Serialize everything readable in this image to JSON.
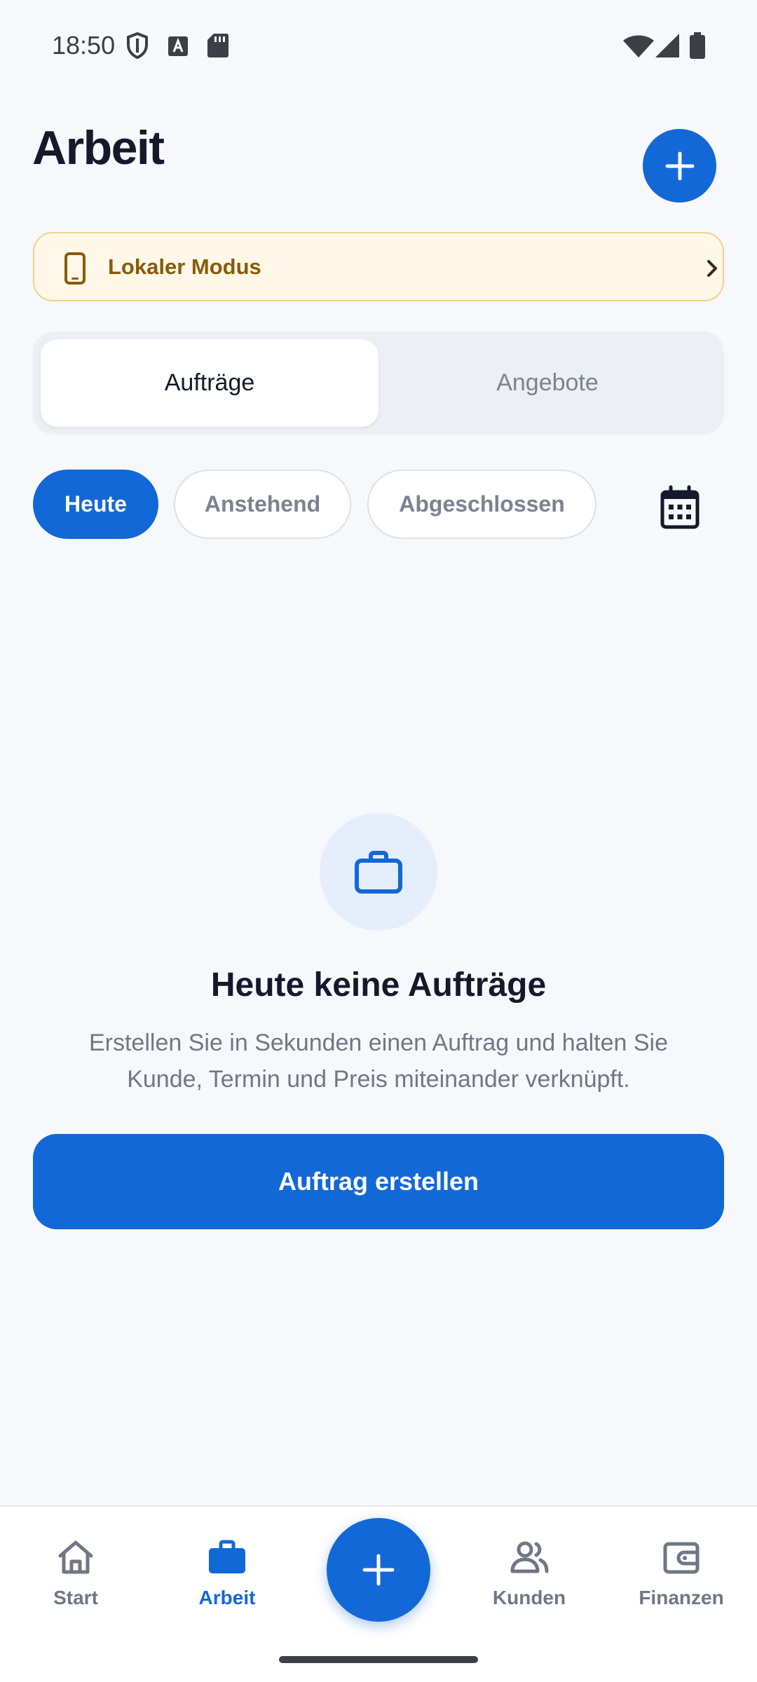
{
  "status_bar": {
    "time": "18:50",
    "icons": [
      "shield-icon",
      "font-a-icon",
      "sd-card-icon",
      "wifi-icon",
      "signal-icon",
      "battery-icon"
    ]
  },
  "header": {
    "title": "Arbeit",
    "add_icon": "plus-icon"
  },
  "local_mode": {
    "icon": "phone-icon",
    "label": "Lokaler Modus",
    "chevron": "chevron-right-icon"
  },
  "segments": {
    "active": "Aufträge",
    "inactive": "Angebote"
  },
  "filters": {
    "today": "Heute",
    "pending": "Anstehend",
    "completed": "Abgeschlossen",
    "calendar_icon": "calendar-icon"
  },
  "empty_state": {
    "icon": "briefcase-icon",
    "title": "Heute keine Aufträge",
    "description": "Erstellen Sie in Sekunden einen Auftrag und halten Sie Kunde, Termin und Preis miteinander verknüpft.",
    "button": "Auftrag erstellen"
  },
  "bottom_nav": {
    "start": "Start",
    "work": "Arbeit",
    "customers": "Kunden",
    "finances": "Finanzen",
    "active": "Arbeit"
  },
  "colors": {
    "primary": "#1268d6",
    "background": "#f6f8fb",
    "banner_bg": "#fff8e8",
    "banner_border": "#f0d38b",
    "banner_text": "#8a5a0b",
    "muted_text": "#707784"
  }
}
